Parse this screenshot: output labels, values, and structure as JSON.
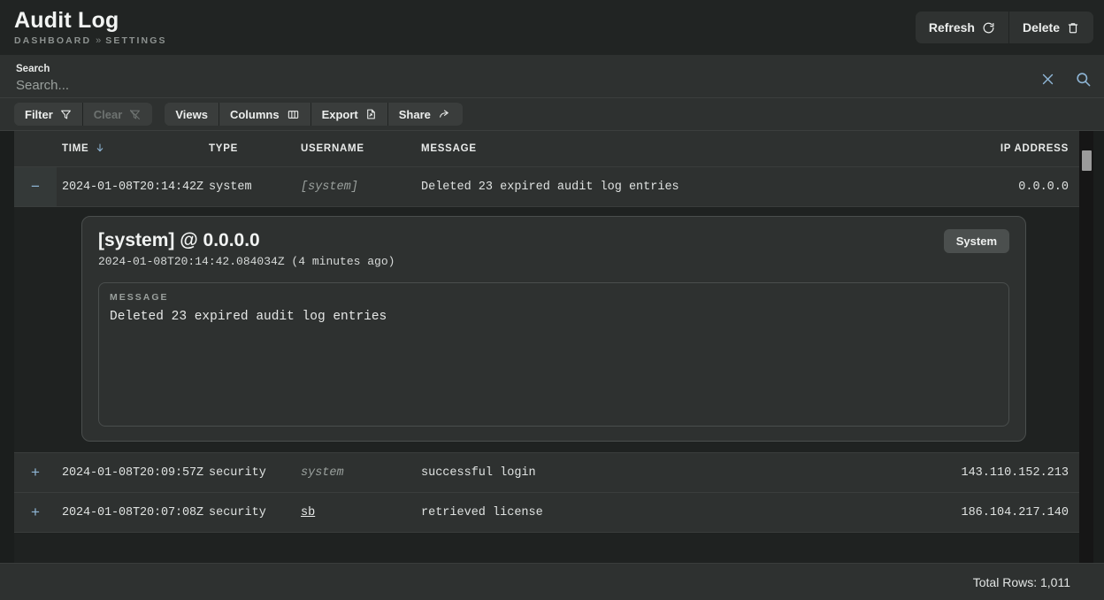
{
  "header": {
    "title": "Audit Log",
    "breadcrumb": {
      "root": "DASHBOARD",
      "separator": "»",
      "current": "SETTINGS"
    },
    "actions": [
      {
        "label": "Refresh",
        "icon": "refresh-icon"
      },
      {
        "label": "Delete",
        "icon": "trash-icon"
      }
    ]
  },
  "search": {
    "label": "Search",
    "value": "",
    "placeholder": "Search...",
    "clear_icon": "close-icon",
    "search_icon": "search-icon"
  },
  "toolbar": {
    "group_one": [
      {
        "label": "Filter",
        "icon": "filter-icon",
        "disabled": false
      },
      {
        "label": "Clear",
        "icon": "filter-off-icon",
        "disabled": true
      }
    ],
    "group_two": [
      {
        "label": "Views",
        "icon": ""
      },
      {
        "label": "Columns",
        "icon": "columns-icon"
      },
      {
        "label": "Export",
        "icon": "file-export-icon"
      },
      {
        "label": "Share",
        "icon": "share-arrow-icon"
      }
    ]
  },
  "table": {
    "columns": [
      {
        "key": "time",
        "label": "TIME",
        "sort": "desc",
        "sort_icon": "arrow-down-icon"
      },
      {
        "key": "type",
        "label": "TYPE"
      },
      {
        "key": "username",
        "label": "USERNAME"
      },
      {
        "key": "message",
        "label": "MESSAGE"
      },
      {
        "key": "ip",
        "label": "IP ADDRESS"
      }
    ],
    "rows": [
      {
        "toggle": "−",
        "expanded": true,
        "time": "2024-01-08T20:14:42Z",
        "type": "system",
        "username": "[system]",
        "username_style": "muted-italic",
        "message": "Deleted 23 expired audit log entries",
        "ip": "0.0.0.0"
      },
      {
        "toggle": "+",
        "expanded": false,
        "time": "2024-01-08T20:09:57Z",
        "type": "security",
        "username": "system",
        "username_style": "muted-italic",
        "message": "successful login",
        "ip": "143.110.152.213"
      },
      {
        "toggle": "+",
        "expanded": false,
        "time": "2024-01-08T20:07:08Z",
        "type": "security",
        "username": "sb",
        "username_style": "link",
        "message": "retrieved license",
        "ip": "186.104.217.140"
      }
    ]
  },
  "detail": {
    "title": "[system] @ 0.0.0.0",
    "timestamp": "2024-01-08T20:14:42.084034Z (4 minutes ago)",
    "badge": "System",
    "field_label": "MESSAGE",
    "field_value": "Deleted 23 expired audit log entries"
  },
  "footer": {
    "total_rows": "Total Rows: 1,011"
  },
  "colors": {
    "accent": "#8fb6d6",
    "background": "#1f2221",
    "panel": "#2e3130",
    "header": "#212423",
    "text": "#e6e8e7",
    "muted": "#9aa09d",
    "scrollbar_thumb": "#9b9b9b"
  }
}
